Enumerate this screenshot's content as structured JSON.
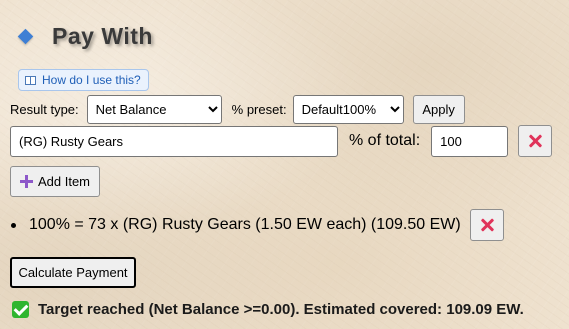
{
  "header": {
    "title": "Pay With",
    "icon": "blue-diamond-icon",
    "accent_color": "#3e7fd4"
  },
  "help": {
    "label": "How do I use this?",
    "icon": "book-icon"
  },
  "controls": {
    "result_type_label": "Result type:",
    "result_type_value": "Net Balance",
    "percent_preset_label": "% preset:",
    "percent_preset_value": "Default100%",
    "apply_label": "Apply"
  },
  "item_entry": {
    "name_value": "(RG) Rusty Gears",
    "percent_label": "% of total:",
    "percent_value": "100",
    "remove_icon": "x-icon"
  },
  "add_item": {
    "label": "Add Item",
    "icon": "plus-icon"
  },
  "results": {
    "items": [
      {
        "text": "100% = 73 x (RG) Rusty Gears (1.50 EW each) (109.50 EW)",
        "remove_icon": "x-icon"
      }
    ]
  },
  "calculate": {
    "label": "Calculate Payment"
  },
  "status": {
    "icon": "check-icon",
    "text": "Target reached (Net Balance >=0.00). Estimated covered: 109.09 EW.",
    "color": "#2fb52f"
  }
}
